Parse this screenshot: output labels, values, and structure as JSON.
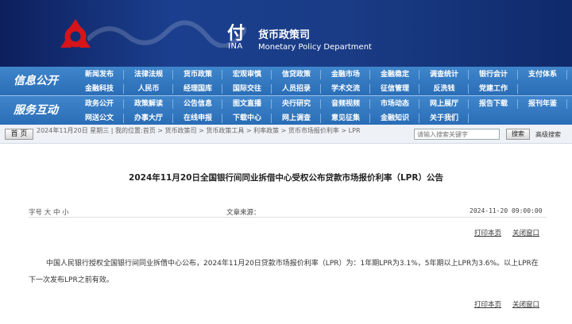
{
  "banner": {
    "dept_cn_prefix": "付",
    "dept_en_prefix": "INA",
    "dept_cn": "货币政策司",
    "dept_en": "Monetary Policy Department",
    "colors": {
      "dark": "#0d1f5c",
      "mid": "#1b3f8e",
      "logo_red": "#d7141a"
    }
  },
  "nav": {
    "section1_title": "信息公开",
    "section2_title": "服务互动",
    "section1_row1": [
      "新闻发布",
      "法律法规",
      "货币政策",
      "宏观审慎",
      "信贷政策",
      "金融市场",
      "金融稳定",
      "调查统计",
      "银行会计",
      "支付体系"
    ],
    "section1_row2": [
      "金融科技",
      "人民币",
      "经理国库",
      "国际交往",
      "人员招录",
      "学术交流",
      "征信管理",
      "反洗钱",
      "党建工作"
    ],
    "section2_row1": [
      "政务公开",
      "政策解读",
      "公告信息",
      "图文直播",
      "央行研究",
      "音频视频",
      "市场动态",
      "网上展厅",
      "报告下载",
      "报刊年鉴"
    ],
    "section2_row2": [
      "网送公文",
      "办事大厅",
      "在线申报",
      "下载中心",
      "网上调查",
      "意见征集",
      "金融知识",
      "关于我们"
    ]
  },
  "breadcrumb": {
    "home_label": "首 页",
    "text": "2024年11月20日 星期三 | 我的位置:首页 > 货币政策司 > 货币政策工具 > 利率政策 > 货币市场报价利率 > LPR",
    "search_placeholder": "请输入搜索关键字",
    "search_button": "搜索",
    "advanced_search": "高级搜索"
  },
  "article": {
    "title": "2024年11月20日全国银行间同业拆借中心受权公布贷款市场报价利率（LPR）公告",
    "font_size_label": "字号",
    "font_large": "大",
    "font_medium": "中",
    "font_small": "小",
    "source_label": "文章来源：",
    "date": "2024-11-20 09:00:00",
    "print_label": "打印本页",
    "close_label": "关闭窗口",
    "body": "中国人民银行授权全国银行间同业拆借中心公布，2024年11月20日贷款市场报价利率（LPR）为：1年期LPR为3.1%，5年期以上LPR为3.6%。以上LPR在下一次发布LPR之前有效。"
  }
}
